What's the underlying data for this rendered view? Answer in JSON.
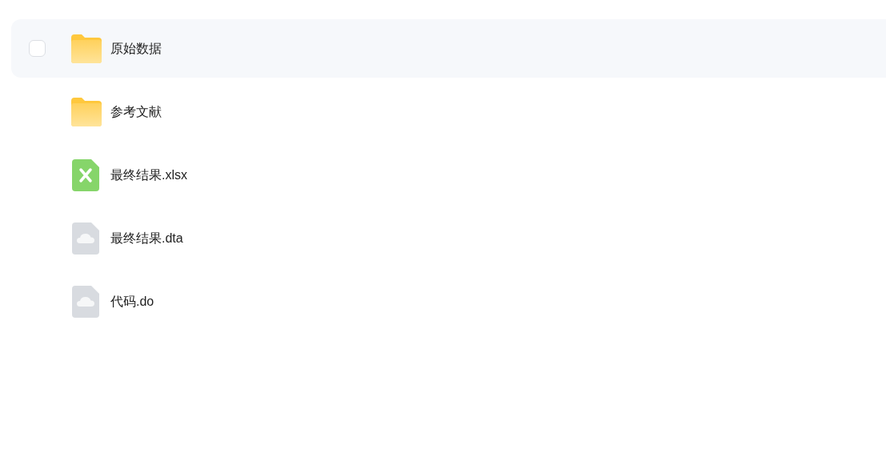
{
  "files": [
    {
      "name": "原始数据",
      "kind": "folder",
      "hovered": true,
      "checked": false
    },
    {
      "name": "参考文献",
      "kind": "folder",
      "hovered": false
    },
    {
      "name": "最终结果.xlsx",
      "kind": "spreadsheet",
      "hovered": false
    },
    {
      "name": "最终结果.dta",
      "kind": "file",
      "hovered": false
    },
    {
      "name": "代码.do",
      "kind": "file",
      "hovered": false
    }
  ]
}
